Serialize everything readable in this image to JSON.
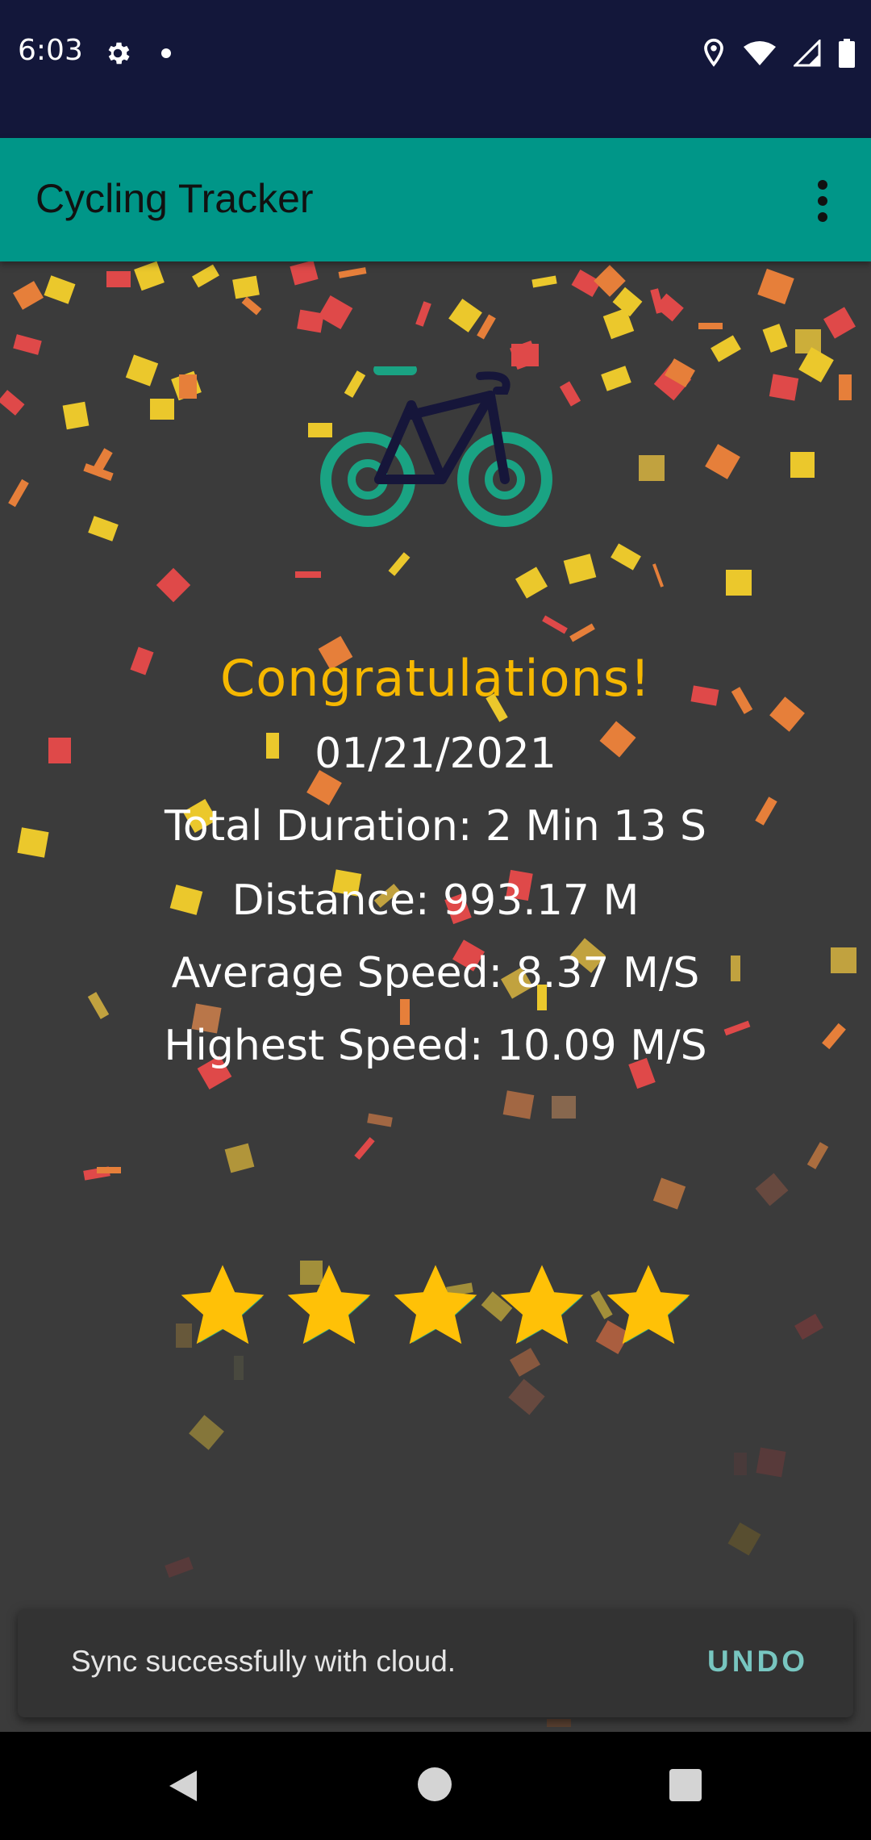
{
  "status_bar": {
    "time": "6:03"
  },
  "app_bar": {
    "title": "Cycling Tracker"
  },
  "result": {
    "headline": "Congratulations!",
    "date": "01/21/2021",
    "total_duration": "Total Duration: 2 Min 13 S",
    "distance": "Distance: 993.17 M",
    "average_speed": "Average Speed: 8.37 M/S",
    "highest_speed": "Highest Speed: 10.09 M/S",
    "rating": 5,
    "rating_max": 5
  },
  "snackbar": {
    "message": "Sync successfully with cloud.",
    "action": "UNDO"
  },
  "colors": {
    "status_bar": "#13173a",
    "app_bar": "#009688",
    "background": "#3b3b3b",
    "headline": "#f6b800",
    "star": "#ffc107",
    "bike_wheels": "#1aa383",
    "bike_frame": "#16163a",
    "snackbar_action": "#78c6c0"
  },
  "icons": {
    "status": [
      "settings-icon",
      "notification-dot-icon",
      "location-icon",
      "wifi-icon",
      "signal-icon",
      "battery-icon"
    ],
    "app_bar": [
      "more-vert-icon"
    ],
    "content": [
      "bicycle-icon",
      "star-icon"
    ],
    "nav": [
      "back-icon",
      "home-icon",
      "recents-icon"
    ]
  }
}
